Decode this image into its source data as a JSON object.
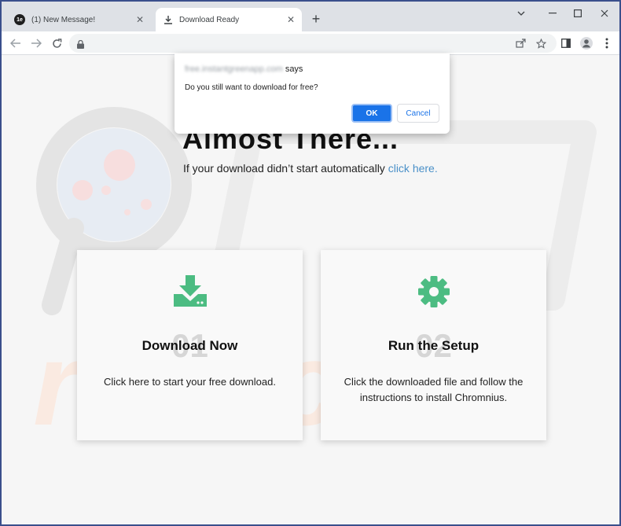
{
  "tabs": [
    {
      "title": "(1) New Message!",
      "favicon": "pc-risk-favicon-icon"
    },
    {
      "title": "Download Ready",
      "favicon": "download-icon"
    }
  ],
  "dialog": {
    "origin": "free.instantgreenapp.com",
    "says": "says",
    "message": "Do you still want to download for free?",
    "ok_label": "OK",
    "cancel_label": "Cancel"
  },
  "page": {
    "heading": "Almost There...",
    "subline_text": "If your download didn’t start automatically",
    "subline_link": "click here."
  },
  "cards": [
    {
      "number": "01",
      "title": "Download Now",
      "description": "Click here to start your free download.",
      "icon": "download-tray-icon"
    },
    {
      "number": "02",
      "title": "Run the Setup",
      "description": "Click the downloaded file and follow the instructions to install Chromnius.",
      "icon": "gear-icon"
    }
  ],
  "colors": {
    "accent_green": "#4cbc82",
    "link_blue": "#4a90c8",
    "button_blue": "#1a73e8"
  }
}
